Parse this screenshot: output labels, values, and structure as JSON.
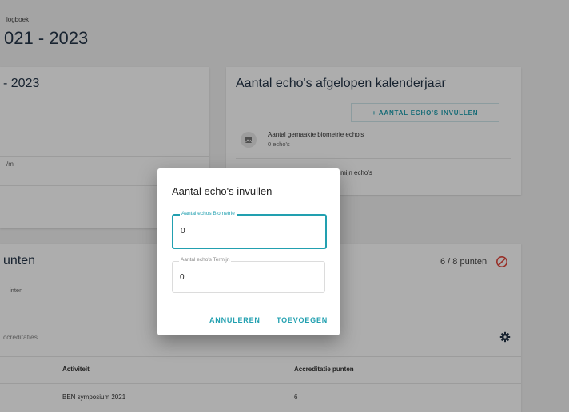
{
  "breadcrumb": "logboek",
  "page_title": "021 - 2023",
  "left_card": {
    "title": "- 2023",
    "item": "/m"
  },
  "echo_card": {
    "title": "Aantal echo's afgelopen kalenderjaar",
    "add_button": "+ AANTAL ECHO'S INVULLEN",
    "items": [
      {
        "label": "Aantal gemaakte biometrie echo's",
        "sub": "0 echo's"
      },
      {
        "label": "ermijn echo's",
        "sub": ""
      }
    ]
  },
  "points_card": {
    "title": "unten",
    "subtitle": "inten",
    "score": "6 / 8 punten",
    "search_placeholder": "ccreditaties...",
    "table": {
      "headers": [
        "Activiteit",
        "Accreditatie punten"
      ],
      "rows": [
        {
          "activity": "BEN symposium 2021",
          "points": "6"
        }
      ]
    }
  },
  "dialog": {
    "title": "Aantal echo's invullen",
    "field_biometrie": {
      "label": "Aantal echos Biometrie",
      "value": "0"
    },
    "field_termijn": {
      "label": "Aantal echo's Termijn",
      "value": "0"
    },
    "cancel": "ANNULEREN",
    "confirm": "TOEVOEGEN"
  },
  "colors": {
    "accent": "#22a0b0",
    "error": "#e0453a"
  }
}
